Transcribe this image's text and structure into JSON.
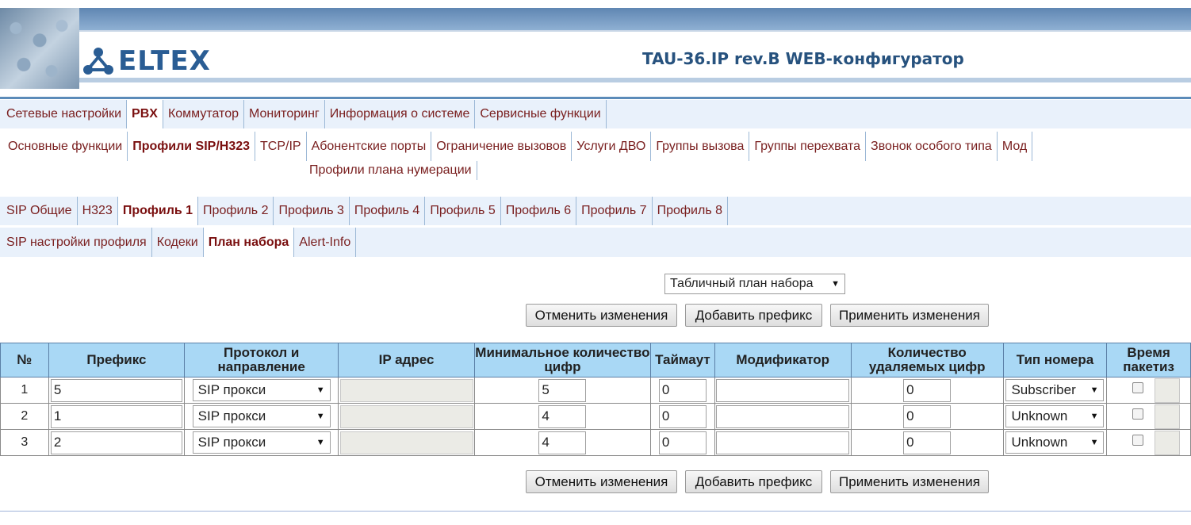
{
  "app": {
    "logo_text": "ELTEX",
    "title": "TAU-36.IP rev.B WEB-конфигуратор"
  },
  "menu_main": [
    {
      "label": "Сетевые настройки",
      "active": false
    },
    {
      "label": "PBX",
      "active": true
    },
    {
      "label": "Коммутатор",
      "active": false
    },
    {
      "label": "Мониторинг",
      "active": false
    },
    {
      "label": "Информация о системе",
      "active": false
    },
    {
      "label": "Сервисные функции",
      "active": false
    }
  ],
  "menu_pbx": [
    {
      "label": "Основные функции",
      "active": false
    },
    {
      "label": "Профили SIP/H323",
      "active": true
    },
    {
      "label": "TCP/IP",
      "active": false
    },
    {
      "label": "Абонентские порты",
      "active": false
    },
    {
      "label": "Ограничение вызовов",
      "active": false
    },
    {
      "label": "Услуги ДВО",
      "active": false
    },
    {
      "label": "Группы вызова",
      "active": false
    },
    {
      "label": "Группы перехвата",
      "active": false
    },
    {
      "label": "Звонок особого типа",
      "active": false
    },
    {
      "label": "Мод",
      "active": false
    }
  ],
  "menu_pbx_row2": [
    {
      "label": "Профили плана нумерации"
    }
  ],
  "menu_profiles": [
    {
      "label": "SIP Общие",
      "active": false
    },
    {
      "label": "H323",
      "active": false
    },
    {
      "label": "Профиль 1",
      "active": true
    },
    {
      "label": "Профиль 2",
      "active": false
    },
    {
      "label": "Профиль 3",
      "active": false
    },
    {
      "label": "Профиль 4",
      "active": false
    },
    {
      "label": "Профиль 5",
      "active": false
    },
    {
      "label": "Профиль 6",
      "active": false
    },
    {
      "label": "Профиль 7",
      "active": false
    },
    {
      "label": "Профиль 8",
      "active": false
    }
  ],
  "menu_profile_sub": [
    {
      "label": "SIP настройки профиля",
      "active": false
    },
    {
      "label": "Кодеки",
      "active": false
    },
    {
      "label": "План набора",
      "active": true
    },
    {
      "label": "Alert-Info",
      "active": false
    }
  ],
  "plan_select": "Табличный план набора",
  "buttons": {
    "cancel": "Отменить изменения",
    "add": "Добавить префикс",
    "apply": "Применить изменения"
  },
  "table": {
    "headers": [
      "№",
      "Префикс",
      "Протокол и направление",
      "IP адрес",
      "Минимальное количество цифр",
      "Таймаут",
      "Модификатор",
      "Количество удаляемых цифр",
      "Тип номера",
      "Время пакетиз"
    ],
    "rows": [
      {
        "num": "1",
        "prefix": "5",
        "protocol": "SIP прокси",
        "ip": "",
        "min_digits": "5",
        "timeout": "0",
        "modifier": "",
        "delete_digits": "0",
        "number_type": "Subscriber"
      },
      {
        "num": "2",
        "prefix": "1",
        "protocol": "SIP прокси",
        "ip": "",
        "min_digits": "4",
        "timeout": "0",
        "modifier": "",
        "delete_digits": "0",
        "number_type": "Unknown"
      },
      {
        "num": "3",
        "prefix": "2",
        "protocol": "SIP прокси",
        "ip": "",
        "min_digits": "4",
        "timeout": "0",
        "modifier": "",
        "delete_digits": "0",
        "number_type": "Unknown"
      }
    ]
  }
}
